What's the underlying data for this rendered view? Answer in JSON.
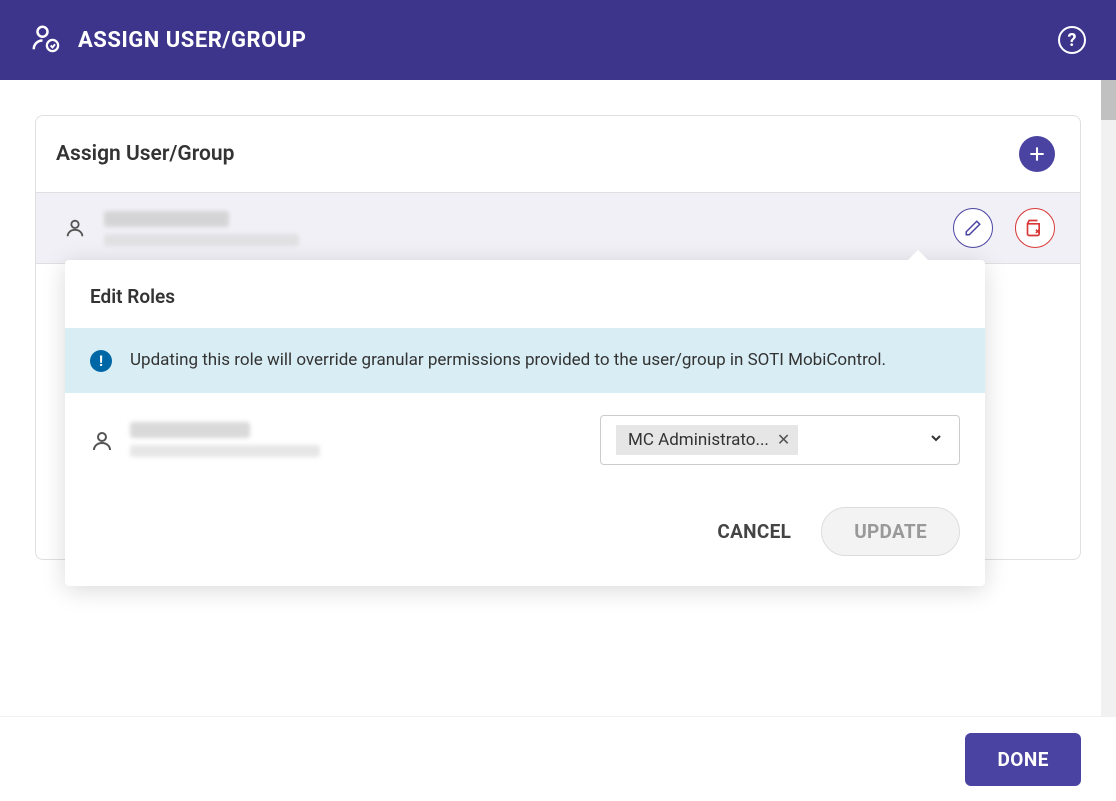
{
  "header": {
    "title": "ASSIGN USER/GROUP"
  },
  "card": {
    "title": "Assign User/Group"
  },
  "popover": {
    "title": "Edit Roles",
    "info_text": "Updating this role will override granular permissions provided to the user/group in SOTI MobiControl.",
    "selected_role": "MC Administrato...",
    "cancel_label": "CANCEL",
    "update_label": "UPDATE"
  },
  "footer": {
    "done_label": "DONE"
  },
  "colors": {
    "brand": "#3d358c",
    "accent": "#4a43a1",
    "danger": "#d93838",
    "info_bg": "#d9edf4",
    "info_icon": "#0067a6"
  }
}
